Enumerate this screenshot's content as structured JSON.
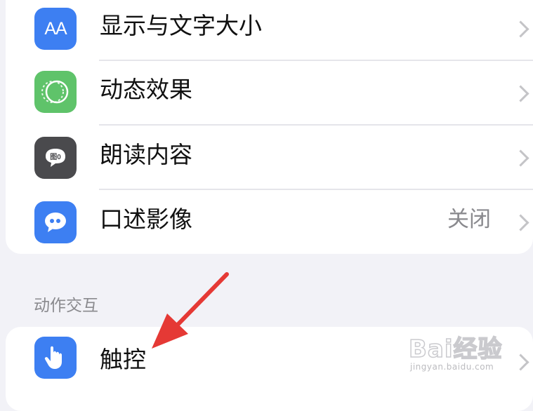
{
  "settings": {
    "rows": [
      {
        "label": "显示与文字大小",
        "value": "",
        "icon": "text-size-icon",
        "icon_glyph": "AA",
        "icon_color": "#3d7ff2"
      },
      {
        "label": "动态效果",
        "value": "",
        "icon": "motion-icon",
        "icon_color": "#5fc36a"
      },
      {
        "label": "朗读内容",
        "value": "",
        "icon": "spoken-content-icon",
        "icon_color": "#4a4a4d"
      },
      {
        "label": "口述影像",
        "value": "关闭",
        "icon": "audio-descriptions-icon",
        "icon_color": "#3d7ff2"
      }
    ],
    "section_header": "动作交互",
    "touch_row": {
      "label": "触控",
      "icon": "touch-icon",
      "icon_color": "#3d7ff2"
    }
  },
  "watermark": {
    "logo_text": "Bai经验",
    "url": "jingyan.baidu.com"
  },
  "annotation": {
    "color": "#e53935"
  }
}
